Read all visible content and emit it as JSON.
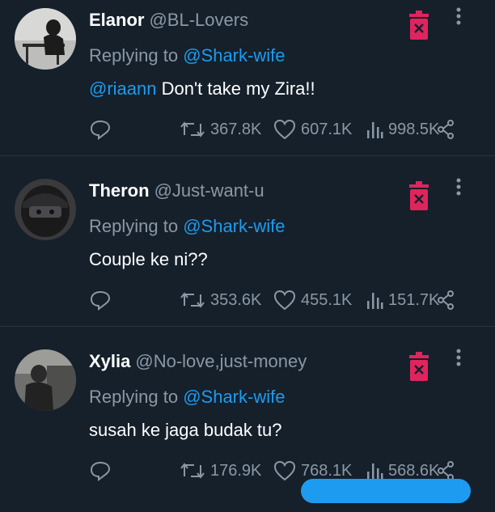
{
  "tweets": [
    {
      "name": "Elanor",
      "handle": "@BL-Lovers",
      "replying_prefix": "Replying to",
      "replying_to": "@Shark-wife",
      "mention": "@riaann",
      "text": " Don't take my Zira!!",
      "retweets": "367.8K",
      "likes": "607.1K",
      "views": "998.5K"
    },
    {
      "name": "Theron",
      "handle": "@Just-want-u",
      "replying_prefix": "Replying to",
      "replying_to": "@Shark-wife",
      "mention": "",
      "text": "Couple ke ni??",
      "retweets": "353.6K",
      "likes": "455.1K",
      "views": "151.7K"
    },
    {
      "name": "Xylia",
      "handle": "@No-love,just-money",
      "replying_prefix": "Replying to",
      "replying_to": "@Shark-wife",
      "mention": "",
      "text": "susah ke jaga budak tu?",
      "retweets": "176.9K",
      "likes": "768.1K",
      "views": "568.6K"
    }
  ],
  "colors": {
    "background": "#15202b",
    "muted": "#8b98a5",
    "link": "#1d9bf0",
    "delete": "#e0245e"
  },
  "icons": [
    "reply-icon",
    "retweet-icon",
    "like-icon",
    "views-icon",
    "share-icon",
    "trash-icon",
    "more-icon"
  ]
}
